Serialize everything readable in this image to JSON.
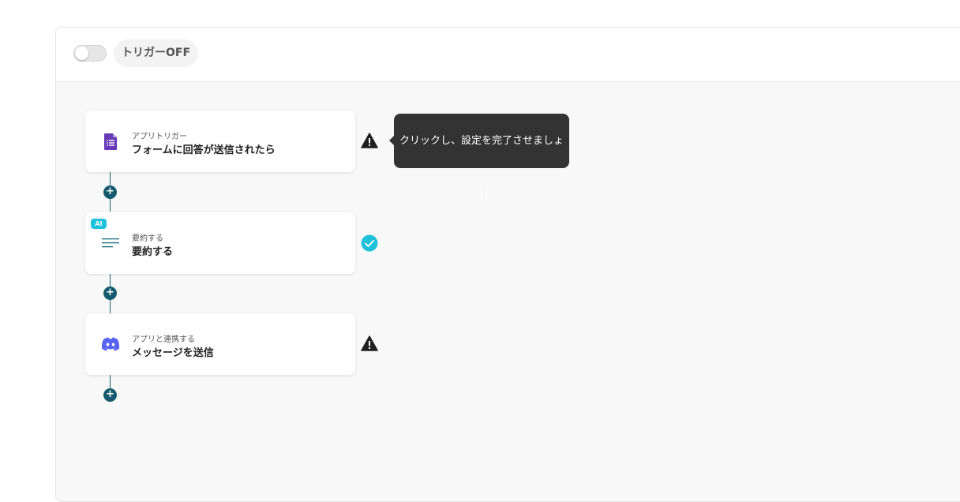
{
  "header": {
    "trigger_label": "トリガーOFF"
  },
  "flow": [
    {
      "subtitle": "アプリトリガー",
      "title": "フォームに回答が送信されたら",
      "icon": "google-forms-icon",
      "status": "warning"
    },
    {
      "subtitle": "要約する",
      "title": "要約する",
      "icon": "summary-lines-icon",
      "badge": "AI",
      "status": "complete"
    },
    {
      "subtitle": "アプリと連携する",
      "title": "メッセージを送信",
      "icon": "discord-icon",
      "status": "warning"
    }
  ],
  "tooltip": {
    "text": "クリックし、設定を完了させましょう!"
  },
  "colors": {
    "accent_dark": "#155a6e",
    "ai_badge": "#1fc0d9",
    "complete": "#1fc0d9",
    "forms_purple": "#673ab7",
    "discord_blue": "#5865f2"
  }
}
